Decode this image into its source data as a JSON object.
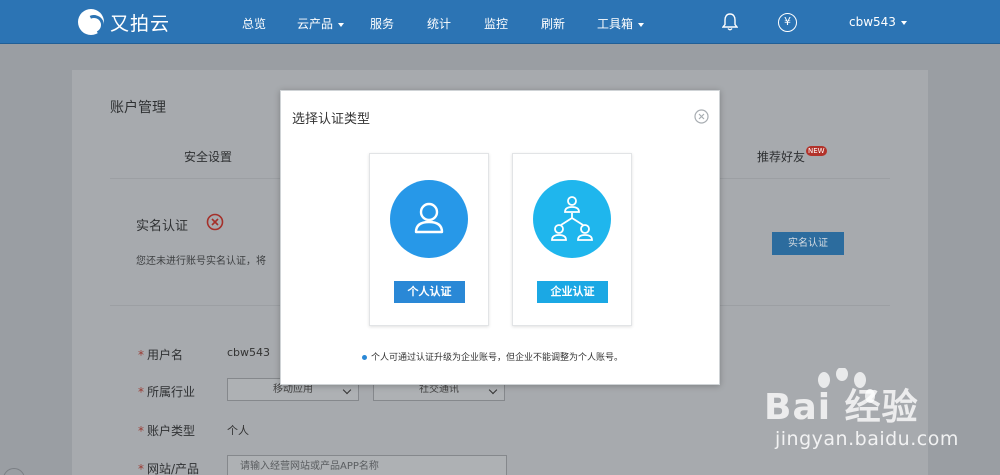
{
  "brand": {
    "name": "又拍云"
  },
  "nav": {
    "items": [
      {
        "label": "总览"
      },
      {
        "label": "云产品"
      },
      {
        "label": "服务"
      },
      {
        "label": "统计"
      },
      {
        "label": "监控"
      },
      {
        "label": "刷新"
      },
      {
        "label": "工具箱"
      }
    ],
    "currency_symbol": "¥",
    "username": "cbw543"
  },
  "account": {
    "title": "账户管理",
    "tabs": [
      {
        "label": "安全设置"
      },
      {
        "label": "推荐好友",
        "badge": "NEW"
      }
    ],
    "realname": {
      "title": "实名认证",
      "description": "您还未进行账号实名认证，将",
      "button": "实名认证"
    },
    "form": {
      "username_label": "用户名",
      "username_value": "cbw543",
      "industry_label": "所属行业",
      "industry_select_1": "移动应用",
      "industry_select_2": "社交通讯",
      "account_type_label": "账户类型",
      "account_type_value": "个人",
      "website_label": "网站/产品",
      "website_placeholder": "请输入经营网站或产品APP名称",
      "required_mark": "*"
    }
  },
  "modal": {
    "title": "选择认证类型",
    "options": [
      {
        "label": "个人认证"
      },
      {
        "label": "企业认证"
      }
    ],
    "note": "个人可通过认证升级为企业账号，但企业不能调整为个人账号。"
  },
  "watermark": {
    "brand": "Bai  经验",
    "url": "jingyan.baidu.com"
  },
  "colors": {
    "topbar": "#2c74b4",
    "personal": "#2798e8",
    "enterprise": "#1fb6ed",
    "danger": "#c0392b"
  }
}
